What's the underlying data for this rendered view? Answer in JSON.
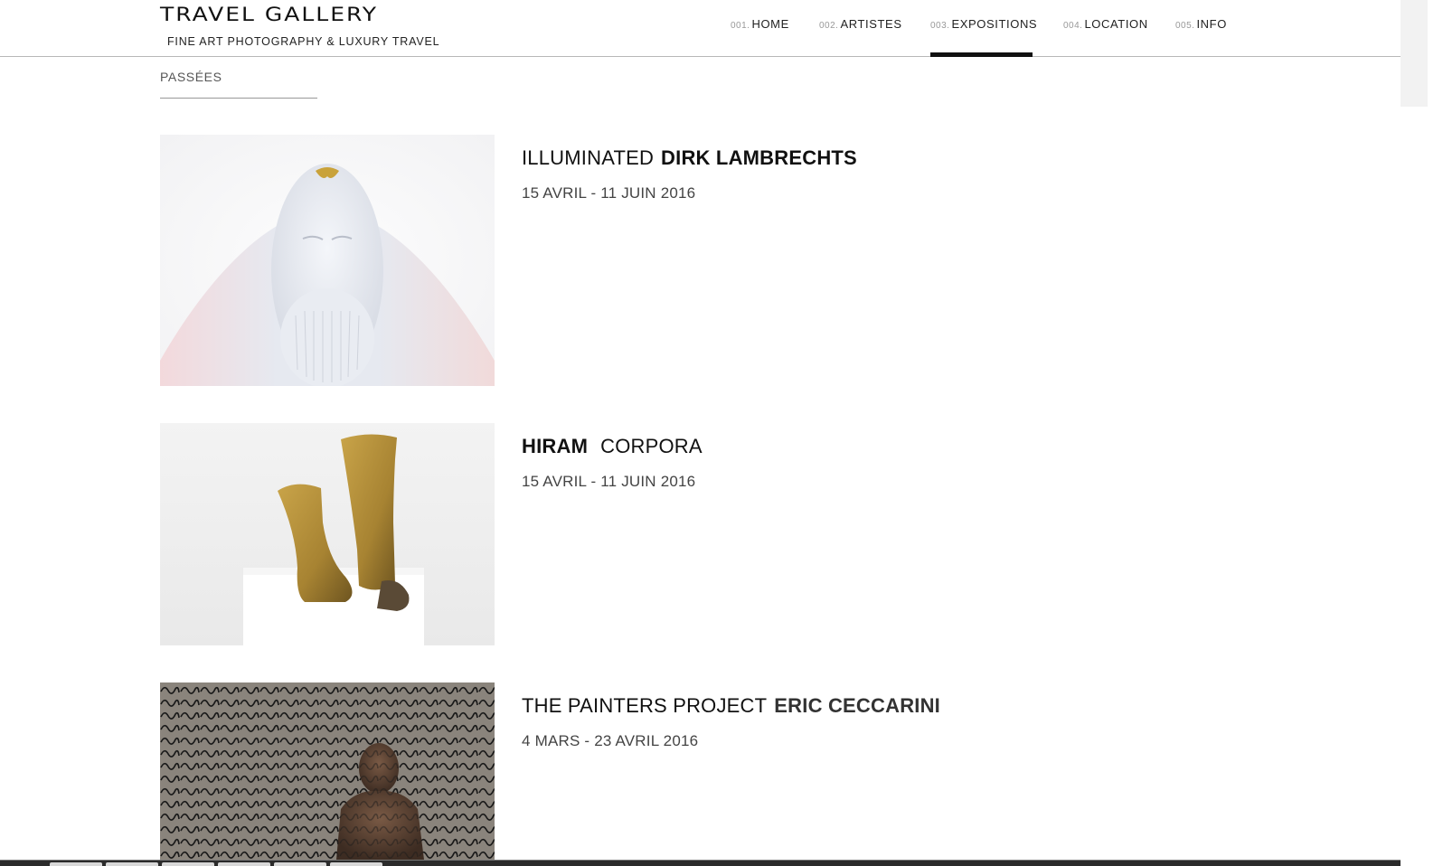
{
  "site": {
    "title": "TRAVEL GALLERY",
    "subtitle": "FINE ART PHOTOGRAPHY & LUXURY TRAVEL"
  },
  "nav": {
    "items": [
      {
        "num": "001.",
        "label": "HOME"
      },
      {
        "num": "002.",
        "label": "ARTISTES"
      },
      {
        "num": "003.",
        "label": "EXPOSITIONS",
        "active": true
      },
      {
        "num": "004.",
        "label": "LOCATION"
      },
      {
        "num": "005.",
        "label": "INFO"
      }
    ]
  },
  "section": {
    "title": "PASSÉES"
  },
  "expositions": [
    {
      "title_light": "ILLUMINATED",
      "title_strong": "DIRK LAMBRECHTS",
      "dates": "15 AVRIL - 11 JUIN 2016"
    },
    {
      "title_strong": "HIRAM",
      "title_light": "CORPORA",
      "dates": "15 AVRIL - 11 JUIN 2016"
    },
    {
      "title_light": "THE PAINTERS PROJECT",
      "title_strong": "ERIC CECCARINI",
      "dates": "4 MARS - 23 AVRIL 2016"
    }
  ],
  "colors": {
    "accent": "#111111",
    "rule": "#b8b8b8"
  }
}
